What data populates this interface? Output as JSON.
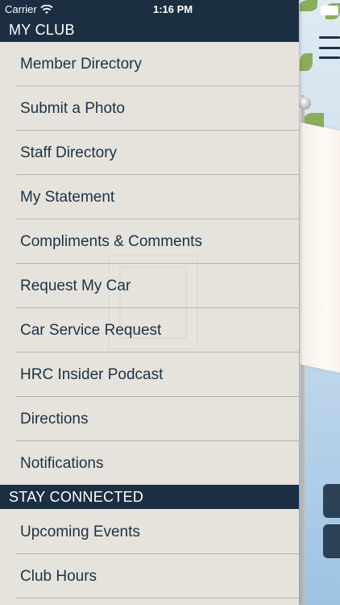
{
  "status_bar": {
    "carrier": "Carrier",
    "time": "1:16 PM"
  },
  "drawer": {
    "sections": [
      {
        "title": "MY CLUB",
        "items": [
          "Member Directory",
          "Submit a Photo",
          "Staff Directory",
          "My Statement",
          "Compliments & Comments",
          "Request My Car",
          "Car Service Request",
          "HRC Insider Podcast",
          "Directions",
          "Notifications"
        ]
      },
      {
        "title": "STAY CONNECTED",
        "items": [
          "Upcoming Events",
          "Club Hours"
        ]
      }
    ]
  },
  "icons": {
    "menu": "hamburger-menu-icon",
    "wifi": "wifi-icon",
    "battery": "battery-icon"
  },
  "colors": {
    "header_bg": "#1c2f42",
    "drawer_bg": "#e6e3dc",
    "text": "#1d3246"
  }
}
